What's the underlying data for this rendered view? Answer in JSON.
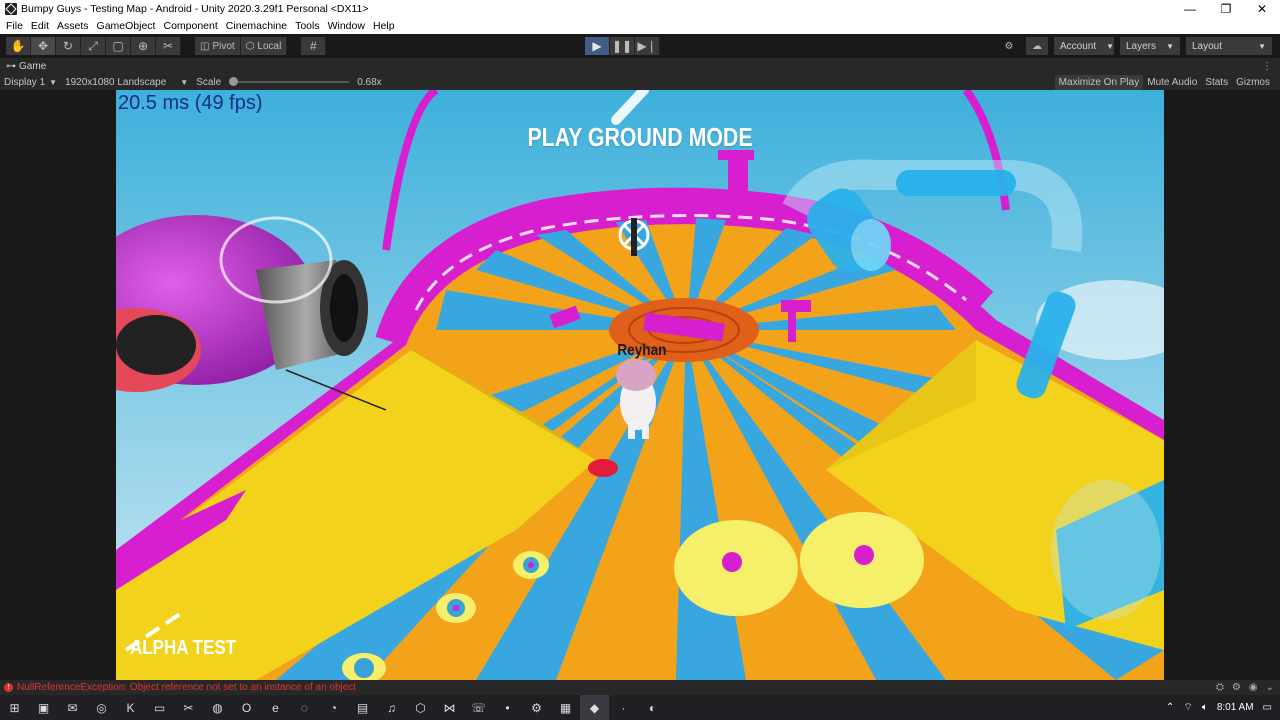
{
  "window": {
    "title": "Bumpy Guys - Testing Map - Android - Unity 2020.3.29f1 Personal <DX11>",
    "minimize": "—",
    "restore": "❐",
    "close": "✕"
  },
  "menu": [
    "File",
    "Edit",
    "Assets",
    "GameObject",
    "Component",
    "Cinemachine",
    "Tools",
    "Window",
    "Help"
  ],
  "toolbar": {
    "pivot_label": "Pivot",
    "local_label": "Local",
    "account_label": "Account",
    "layers_label": "Layers",
    "layout_label": "Layout"
  },
  "game_tab": {
    "label": "Game"
  },
  "game_controls": {
    "display": "Display 1",
    "resolution": "1920x1080 Landscape",
    "scale_label": "Scale",
    "scale_value": "0.68x",
    "maximize": "Maximize On Play",
    "mute": "Mute Audio",
    "stats": "Stats",
    "gizmos": "Gizmos"
  },
  "game_view": {
    "fps": "20.5 ms (49 fps)",
    "mode_title": "PLAY GROUND MODE",
    "player_name": "Reyhan",
    "build_label": "ALPHA TEST"
  },
  "console": {
    "message": "NullReferenceException: Object reference not set to an instance of an object"
  },
  "taskbar": {
    "time": "8:01 AM"
  },
  "colors": {
    "play_active": "#3f5d86",
    "sky": "#46b8dd",
    "magenta": "#d81fd0",
    "yellow": "#f2d21a",
    "blue_stripe": "#38a7e0",
    "orange": "#f3a31a"
  }
}
